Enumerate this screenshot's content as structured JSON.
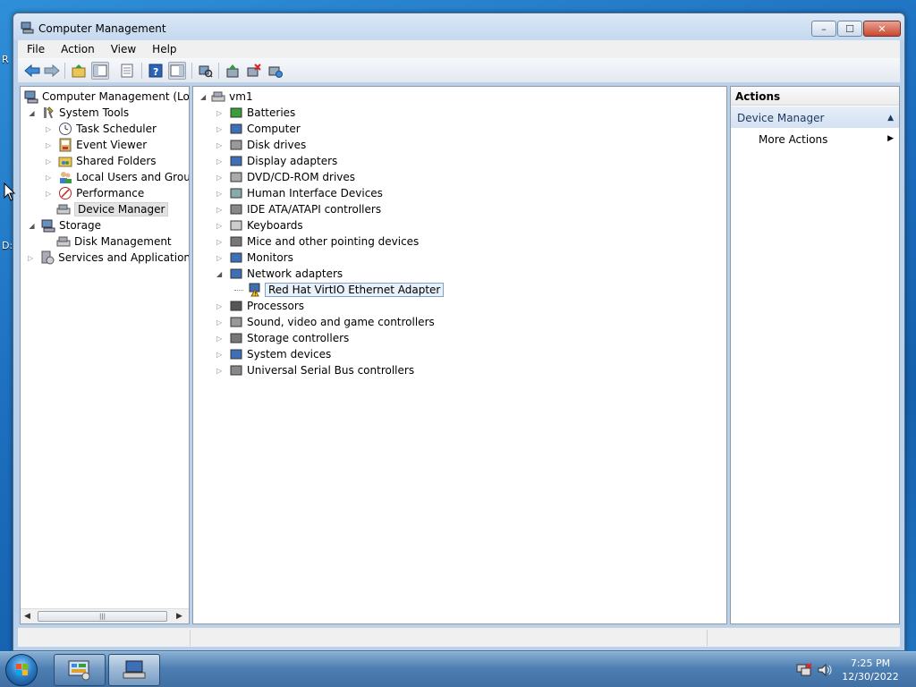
{
  "window": {
    "title": "Computer Management",
    "caption_min": "–",
    "caption_max": "☐",
    "caption_close": "✕"
  },
  "menu": [
    "File",
    "Action",
    "View",
    "Help"
  ],
  "left_tree": {
    "root": "Computer Management (Local",
    "system_tools": "System Tools",
    "task_scheduler": "Task Scheduler",
    "event_viewer": "Event Viewer",
    "shared_folders": "Shared Folders",
    "local_users": "Local Users and Groups",
    "performance": "Performance",
    "device_manager": "Device Manager",
    "storage": "Storage",
    "disk_management": "Disk Management",
    "services": "Services and Applications"
  },
  "device_tree": {
    "root": "vm1",
    "items": [
      "Batteries",
      "Computer",
      "Disk drives",
      "Display adapters",
      "DVD/CD-ROM drives",
      "Human Interface Devices",
      "IDE ATA/ATAPI controllers",
      "Keyboards",
      "Mice and other pointing devices",
      "Monitors",
      "Network adapters"
    ],
    "child": "Red Hat VirtIO Ethernet Adapter",
    "items_after": [
      "Processors",
      "Sound, video and game controllers",
      "Storage controllers",
      "System devices",
      "Universal Serial Bus controllers"
    ]
  },
  "actions": {
    "header": "Actions",
    "section": "Device Manager",
    "more": "More Actions"
  },
  "taskbar": {
    "time": "7:25 PM",
    "date": "12/30/2022"
  },
  "desktop": {
    "edge_text_1": "R",
    "edge_text_2": "D:"
  }
}
